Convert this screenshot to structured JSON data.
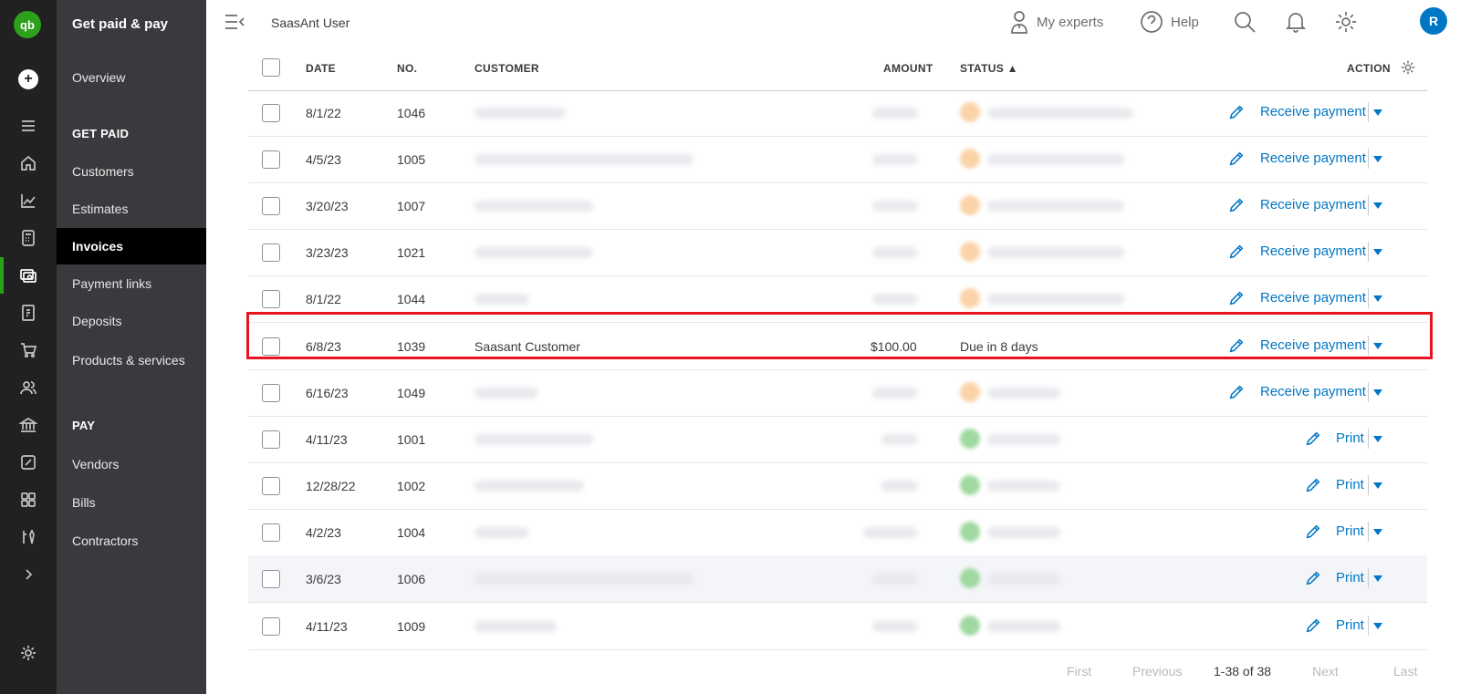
{
  "rail": {
    "logo": "qb",
    "plus": "+",
    "icons": [
      "menu-icon",
      "home-icon",
      "chart-icon",
      "calculator-icon",
      "payments-icon",
      "ledger-icon",
      "cart-icon",
      "people-icon",
      "bank-icon",
      "tax-icon",
      "apps-icon",
      "tools-icon",
      "chevron-right-icon",
      "gear-icon"
    ]
  },
  "nav": {
    "title": "Get paid & pay",
    "overview": "Overview",
    "get_paid_section": "GET PAID",
    "customers": "Customers",
    "estimates": "Estimates",
    "invoices": "Invoices",
    "payment_links": "Payment links",
    "deposits": "Deposits",
    "products_services": "Products & services",
    "pay_section": "PAY",
    "vendors": "Vendors",
    "bills": "Bills",
    "contractors": "Contractors"
  },
  "topbar": {
    "company": "SaasAnt User",
    "my_experts": "My experts",
    "help": "Help",
    "avatar_initial": "R"
  },
  "table": {
    "headers": {
      "date": "DATE",
      "no": "NO.",
      "customer": "CUSTOMER",
      "amount": "AMOUNT",
      "status": "STATUS ▲",
      "action": "ACTION"
    },
    "rows": [
      {
        "date": "8/1/22",
        "no": "1046",
        "customer": "",
        "amount": "",
        "status": "",
        "action": "Receive payment"
      },
      {
        "date": "4/5/23",
        "no": "1005",
        "customer": "",
        "amount": "",
        "status": "",
        "action": "Receive payment"
      },
      {
        "date": "3/20/23",
        "no": "1007",
        "customer": "",
        "amount": "",
        "status": "",
        "action": "Receive payment"
      },
      {
        "date": "3/23/23",
        "no": "1021",
        "customer": "",
        "amount": "",
        "status": "",
        "action": "Receive payment"
      },
      {
        "date": "8/1/22",
        "no": "1044",
        "customer": "",
        "amount": "",
        "status": "",
        "action": "Receive payment"
      },
      {
        "date": "6/8/23",
        "no": "1039",
        "customer": "Saasant Customer",
        "amount": "$100.00",
        "status": "Due in 8 days",
        "action": "Receive payment"
      },
      {
        "date": "6/16/23",
        "no": "1049",
        "customer": "",
        "amount": "",
        "status": "",
        "action": "Receive payment"
      },
      {
        "date": "4/11/23",
        "no": "1001",
        "customer": "",
        "amount": "",
        "status": "",
        "action": "Print"
      },
      {
        "date": "12/28/22",
        "no": "1002",
        "customer": "",
        "amount": "",
        "status": "",
        "action": "Print"
      },
      {
        "date": "4/2/23",
        "no": "1004",
        "customer": "",
        "amount": "",
        "status": "",
        "action": "Print"
      },
      {
        "date": "3/6/23",
        "no": "1006",
        "customer": "",
        "amount": "",
        "status": "",
        "action": "Print"
      },
      {
        "date": "4/11/23",
        "no": "1009",
        "customer": "",
        "amount": "",
        "status": "",
        "action": "Print"
      }
    ]
  },
  "pagination": {
    "first": "First",
    "previous": "Previous",
    "range": "1-38 of 38",
    "next": "Next",
    "last": "Last"
  },
  "colors": {
    "accent": "#0077c5",
    "brand": "#2ca01c",
    "highlight": "#e8141f",
    "overdue": "#fbd3a8",
    "paid": "#9fd8a0"
  }
}
